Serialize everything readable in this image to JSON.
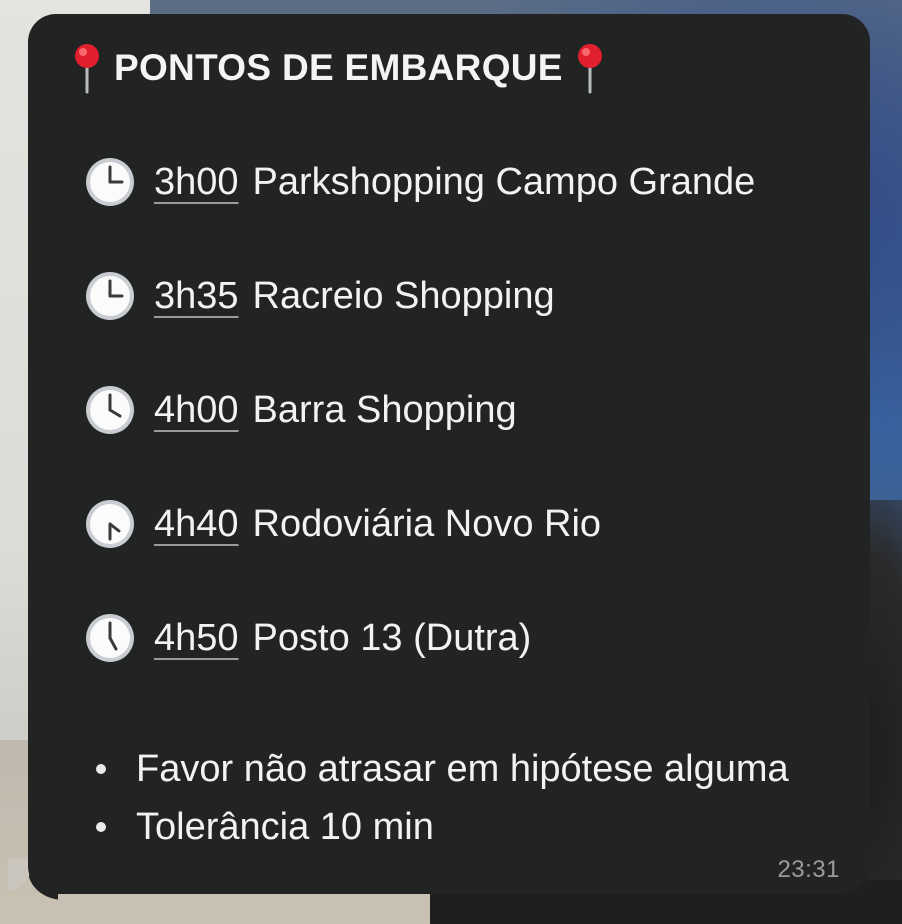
{
  "message": {
    "title": "PONTOS DE EMBARQUE",
    "title_icon": "round-pushpin-icon",
    "stops": [
      {
        "icon": "clock-three-icon",
        "time": "3h00",
        "place": "Parkshopping Campo Grande"
      },
      {
        "icon": "clock-three-icon",
        "time": "3h35",
        "place": "Racreio Shopping"
      },
      {
        "icon": "clock-four-icon",
        "time": "4h00",
        "place": "Barra Shopping"
      },
      {
        "icon": "clock-four-thirty-icon",
        "time": "4h40",
        "place": "Rodoviária Novo Rio"
      },
      {
        "icon": "clock-five-icon",
        "time": "4h50",
        "place": "Posto 13 (Dutra)"
      }
    ],
    "notes": [
      "Favor não atrasar em hipótese alguma",
      "Tolerância 10 min"
    ],
    "timestamp": "23:31"
  },
  "colors": {
    "bubble_background": "#222323",
    "text": "#f2f2f2",
    "timestamp": "#9a9b9c",
    "pin_red": "#e0202c"
  }
}
